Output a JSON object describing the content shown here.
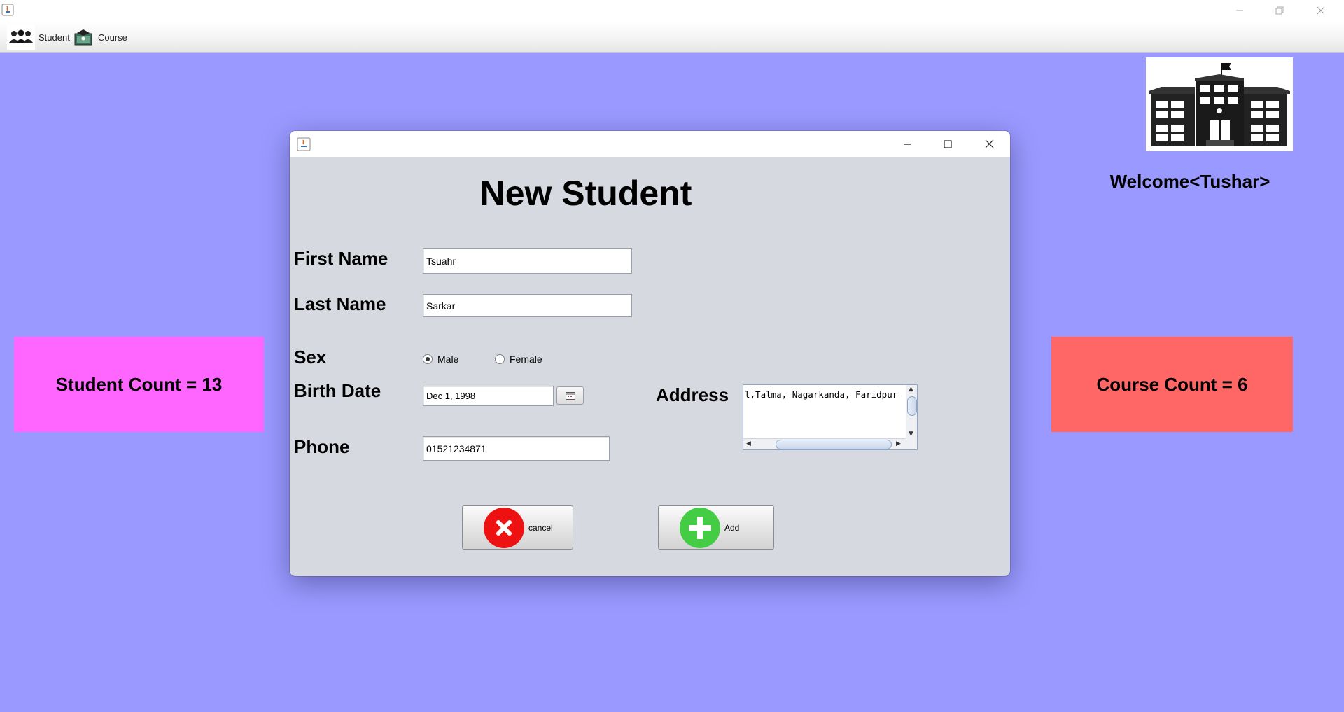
{
  "toolbar": {
    "items": [
      {
        "label": "Student",
        "icon": "students-icon"
      },
      {
        "label": "Course",
        "icon": "course-icon"
      }
    ]
  },
  "welcome": "Welcome<Tushar>",
  "student_count": "Student Count = 13",
  "course_count": "Course Count = 6",
  "dialog": {
    "heading": "New Student",
    "labels": {
      "first_name": "First Name",
      "last_name": "Last Name",
      "sex": "Sex",
      "birth_date": "Birth Date",
      "address": "Address",
      "phone": "Phone"
    },
    "fields": {
      "first_name": "Tsuahr",
      "last_name": "Sarkar",
      "birth_date": "Dec 1, 1998",
      "phone": "01521234871",
      "address": "l,Talma, Nagarkanda, Faridpur"
    },
    "sex_options": [
      {
        "label": "Male",
        "selected": true
      },
      {
        "label": "Female",
        "selected": false
      }
    ],
    "buttons": {
      "cancel": "cancel",
      "add": "Add"
    }
  },
  "colors": {
    "background": "#9999ff",
    "student_count_bg": "#ff66ff",
    "course_count_bg": "#ff6666",
    "dialog_bg": "#d6d9df",
    "cancel_icon": "#ee1111",
    "add_icon": "#44cc44"
  }
}
